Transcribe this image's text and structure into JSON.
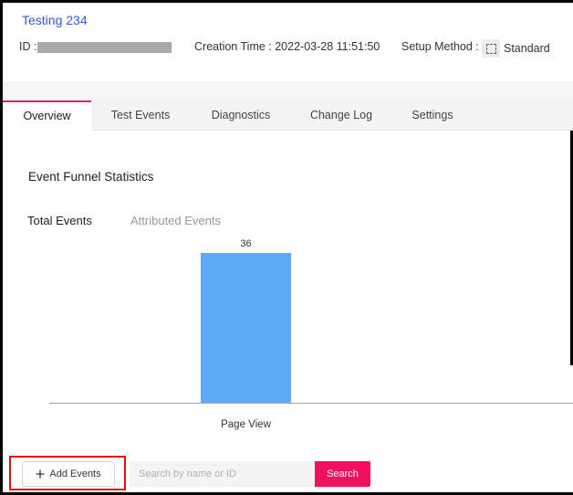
{
  "header": {
    "title": "Testing 234",
    "id_label": "ID :",
    "creation_time": "Creation Time : 2022-03-28 11:51:50",
    "setup_method_label": "Setup Method :",
    "setup_method_value": "Standard",
    "setup_icon": "square-dashed-icon"
  },
  "tabs": [
    {
      "label": "Overview",
      "active": true
    },
    {
      "label": "Test Events",
      "active": false
    },
    {
      "label": "Diagnostics",
      "active": false
    },
    {
      "label": "Change Log",
      "active": false
    },
    {
      "label": "Settings",
      "active": false
    }
  ],
  "overview": {
    "section_title": "Event Funnel Statistics",
    "sub_tabs": [
      {
        "label": "Total Events",
        "active": true
      },
      {
        "label": "Attributed Events",
        "active": false
      }
    ]
  },
  "chart_data": {
    "type": "bar",
    "categories": [
      "Page View"
    ],
    "values": [
      36
    ],
    "color": "#5da9f7",
    "grid": false
  },
  "actions": {
    "add_events_label": "Add Events",
    "add_icon": "plus-icon",
    "search_placeholder": "Search by name or ID",
    "search_value": "",
    "search_button_label": "Search"
  },
  "colors": {
    "accent": "#f0125f",
    "link": "#2f5bd3",
    "highlight_box": "#e01010"
  }
}
